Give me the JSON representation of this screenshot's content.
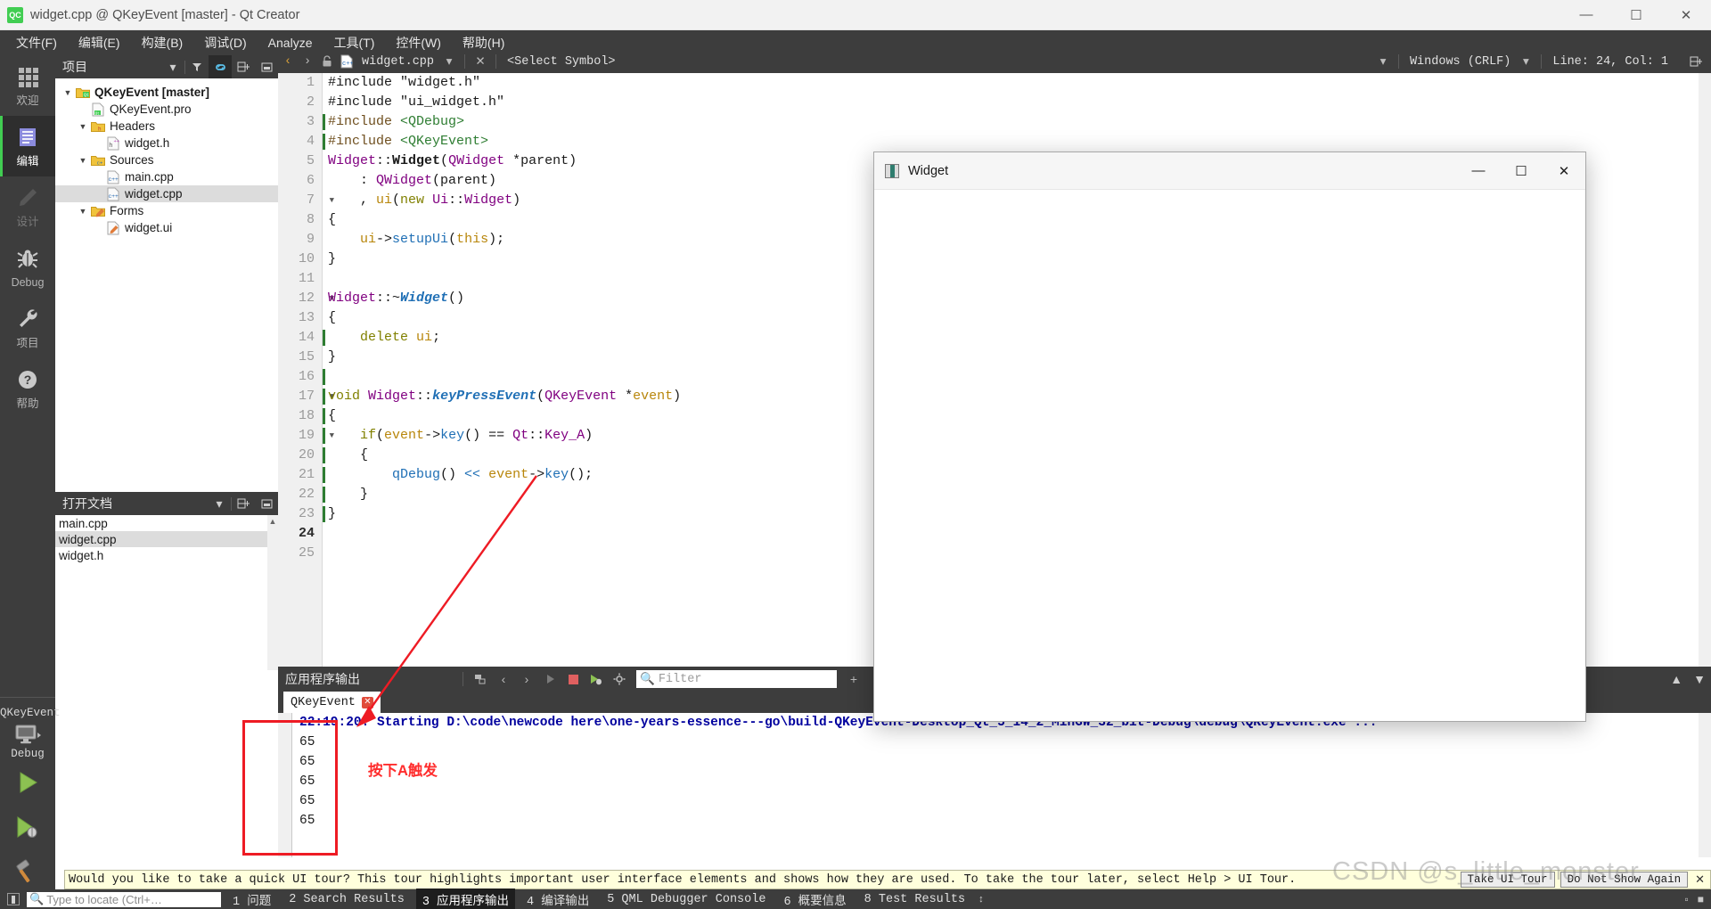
{
  "window": {
    "title": "widget.cpp @ QKeyEvent [master] - Qt Creator",
    "logo_text": "QC",
    "minimize": "—",
    "maximize": "☐",
    "close": "✕"
  },
  "menubar": {
    "items": [
      {
        "label": "文件(F)",
        "name": "menu-file"
      },
      {
        "label": "编辑(E)",
        "name": "menu-edit"
      },
      {
        "label": "构建(B)",
        "name": "menu-build"
      },
      {
        "label": "调试(D)",
        "name": "menu-debug"
      },
      {
        "label": "Analyze",
        "name": "menu-analyze"
      },
      {
        "label": "工具(T)",
        "name": "menu-tools"
      },
      {
        "label": "控件(W)",
        "name": "menu-widgets"
      },
      {
        "label": "帮助(H)",
        "name": "menu-help"
      }
    ]
  },
  "modebar": {
    "items": [
      {
        "label": "欢迎",
        "icon": "grid-icon",
        "active": false,
        "dim": false
      },
      {
        "label": "编辑",
        "icon": "edit-document-icon",
        "active": true,
        "dim": false
      },
      {
        "label": "设计",
        "icon": "pencil-icon",
        "active": false,
        "dim": true
      },
      {
        "label": "Debug",
        "icon": "bug-icon",
        "active": false,
        "dim": false
      },
      {
        "label": "项目",
        "icon": "wrench-icon",
        "active": false,
        "dim": false
      },
      {
        "label": "帮助",
        "icon": "question-circle-icon",
        "active": false,
        "dim": false
      }
    ],
    "kit_name": "QKeyEvent",
    "kit_mode": "Debug",
    "run_button": "run-icon",
    "debug_button": "run-debug-icon",
    "build_button": "hammer-icon"
  },
  "project_panel": {
    "title": "项目",
    "tree": [
      {
        "label": "QKeyEvent [master]",
        "icon": "qt-project-icon",
        "indent": 0,
        "twisty": "▼",
        "bold": true,
        "selected": false
      },
      {
        "label": "QKeyEvent.pro",
        "icon": "pro-file-icon",
        "indent": 1,
        "twisty": "",
        "bold": false,
        "selected": false
      },
      {
        "label": "Headers",
        "icon": "folder-h-icon",
        "indent": 1,
        "twisty": "▼",
        "bold": false,
        "selected": false
      },
      {
        "label": "widget.h",
        "icon": "header-file-icon",
        "indent": 2,
        "twisty": "",
        "bold": false,
        "selected": false
      },
      {
        "label": "Sources",
        "icon": "folder-cpp-icon",
        "indent": 1,
        "twisty": "▼",
        "bold": false,
        "selected": false
      },
      {
        "label": "main.cpp",
        "icon": "cpp-file-icon",
        "indent": 2,
        "twisty": "",
        "bold": false,
        "selected": false
      },
      {
        "label": "widget.cpp",
        "icon": "cpp-file-icon",
        "indent": 2,
        "twisty": "",
        "bold": false,
        "selected": true
      },
      {
        "label": "Forms",
        "icon": "folder-ui-icon",
        "indent": 1,
        "twisty": "▼",
        "bold": false,
        "selected": false
      },
      {
        "label": "widget.ui",
        "icon": "ui-file-icon",
        "indent": 2,
        "twisty": "",
        "bold": false,
        "selected": false
      }
    ]
  },
  "open_documents": {
    "title": "打开文档",
    "items": [
      {
        "label": "main.cpp",
        "selected": false
      },
      {
        "label": "widget.cpp",
        "selected": true
      },
      {
        "label": "widget.h",
        "selected": false
      }
    ]
  },
  "editor_bar": {
    "back": "‹",
    "forward": "›",
    "lock": "🔓",
    "filename": "widget.cpp",
    "close_x": "✕",
    "symbol_selector": "<Select Symbol>",
    "line_ending": "Windows (CRLF)",
    "cursor_pos": "Line: 24, Col: 1",
    "split": "⊞"
  },
  "editor": {
    "lines": [
      {
        "n": "1",
        "fold": "",
        "changed": false,
        "text": "#include \"widget.h\""
      },
      {
        "n": "2",
        "fold": "",
        "changed": false,
        "text": "#include \"ui_widget.h\""
      },
      {
        "n": "3",
        "fold": "",
        "changed": true,
        "text": "#include <QDebug>"
      },
      {
        "n": "4",
        "fold": "",
        "changed": true,
        "text": "#include <QKeyEvent>"
      },
      {
        "n": "5",
        "fold": "",
        "changed": false,
        "text": "Widget::Widget(QWidget *parent)"
      },
      {
        "n": "6",
        "fold": "",
        "changed": false,
        "text": "    : QWidget(parent)"
      },
      {
        "n": "7",
        "fold": "▼",
        "changed": false,
        "text": "    , ui(new Ui::Widget)"
      },
      {
        "n": "8",
        "fold": "",
        "changed": false,
        "text": "{"
      },
      {
        "n": "9",
        "fold": "",
        "changed": false,
        "text": "    ui->setupUi(this);"
      },
      {
        "n": "10",
        "fold": "",
        "changed": false,
        "text": "}"
      },
      {
        "n": "11",
        "fold": "",
        "changed": false,
        "text": ""
      },
      {
        "n": "12",
        "fold": "▼",
        "changed": false,
        "text": "Widget::~Widget()"
      },
      {
        "n": "13",
        "fold": "",
        "changed": false,
        "text": "{"
      },
      {
        "n": "14",
        "fold": "",
        "changed": true,
        "text": "    delete ui;"
      },
      {
        "n": "15",
        "fold": "",
        "changed": false,
        "text": "}"
      },
      {
        "n": "16",
        "fold": "",
        "changed": true,
        "text": ""
      },
      {
        "n": "17",
        "fold": "▼",
        "changed": true,
        "text": "void Widget::keyPressEvent(QKeyEvent *event)"
      },
      {
        "n": "18",
        "fold": "",
        "changed": true,
        "text": "{"
      },
      {
        "n": "19",
        "fold": "▼",
        "changed": true,
        "text": "    if(event->key() == Qt::Key_A)"
      },
      {
        "n": "20",
        "fold": "",
        "changed": true,
        "text": "    {"
      },
      {
        "n": "21",
        "fold": "",
        "changed": true,
        "text": "        qDebug() << event->key();"
      },
      {
        "n": "22",
        "fold": "",
        "changed": true,
        "text": "    }"
      },
      {
        "n": "23",
        "fold": "",
        "changed": true,
        "text": "}"
      },
      {
        "n": "24",
        "fold": "",
        "changed": false,
        "text": "",
        "current": true
      },
      {
        "n": "25",
        "fold": "",
        "changed": false,
        "text": ""
      }
    ]
  },
  "output_pane": {
    "title": "应用程序输出",
    "filter_placeholder": "Filter",
    "tab_label": "QKeyEvent",
    "tab_close": "✕",
    "add": "+",
    "remove": "−",
    "lines": [
      {
        "text": "22:19:20: Starting D:\\code\\newcode here\\one-years-essence---go\\build-QKeyEvent-Desktop_Qt_5_14_2_MinGW_32_bit-Debug\\debug\\QKeyEvent.exe ...",
        "kind": "start"
      },
      {
        "text": "65",
        "kind": "normal"
      },
      {
        "text": "65",
        "kind": "normal"
      },
      {
        "text": "65",
        "kind": "normal"
      },
      {
        "text": "65",
        "kind": "normal"
      },
      {
        "text": "65",
        "kind": "normal"
      }
    ]
  },
  "annotations": {
    "callout_text": "按下A触发",
    "callout_color": "#ff2d2d",
    "box_color": "#ee1b24"
  },
  "widget_dialog": {
    "title": "Widget",
    "minimize": "—",
    "maximize": "☐",
    "close": "✕"
  },
  "tour_banner": {
    "text": "Would you like to take a quick UI tour? This tour highlights important user interface elements and shows how they are used. To take the tour later, select Help > UI Tour.",
    "take_tour": "Take UI Tour",
    "do_not_show": "Do Not Show Again",
    "close": "✕"
  },
  "statusbar": {
    "locate_placeholder": "Type to locate (Ctrl+…",
    "tabs": [
      {
        "label": "1 问题",
        "active": false
      },
      {
        "label": "2 Search Results",
        "active": false
      },
      {
        "label": "3 应用程序输出",
        "active": true
      },
      {
        "label": "4 编译输出",
        "active": false
      },
      {
        "label": "5 QML Debugger Console",
        "active": false
      },
      {
        "label": "6 概要信息",
        "active": false
      },
      {
        "label": "8 Test Results",
        "active": false
      }
    ],
    "updown": "↕"
  },
  "watermark": {
    "text": "CSDN @s_little_monster"
  },
  "colors": {
    "accent_green": "#41cd52",
    "chrome_dark": "#3d3d3d",
    "selection_gray": "#dcdcdc",
    "output_blue": "#00009e",
    "annotation_red": "#ee1b24"
  }
}
